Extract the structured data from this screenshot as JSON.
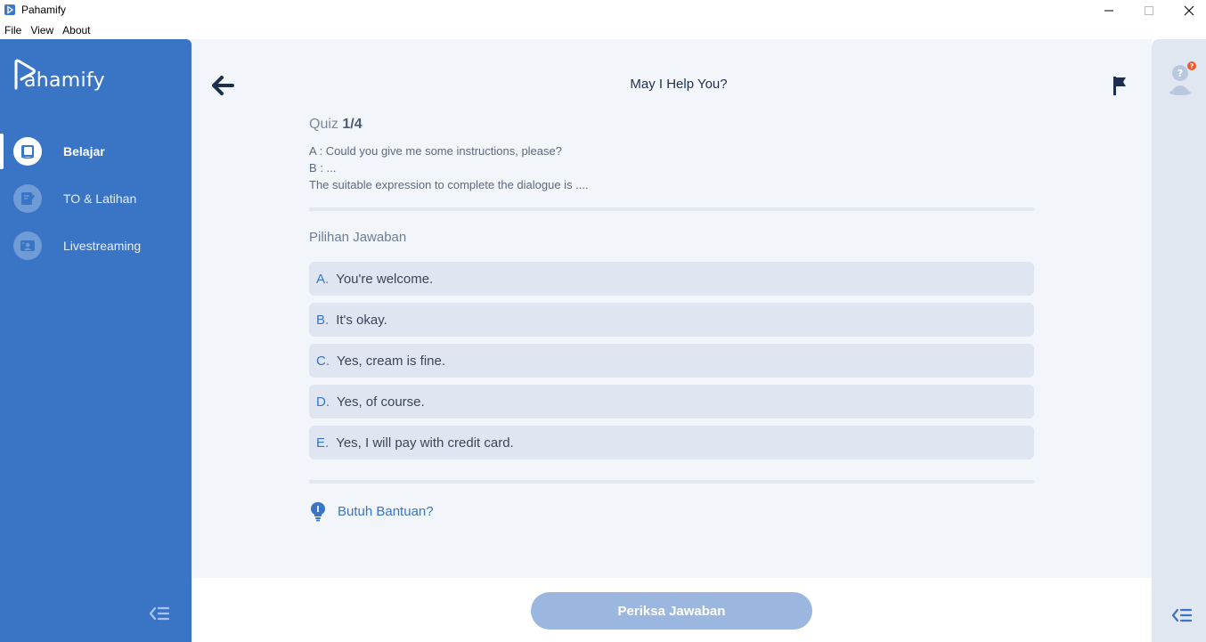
{
  "window": {
    "title": "Pahamify"
  },
  "menu": {
    "items": [
      "File",
      "View",
      "About"
    ]
  },
  "sidebar": {
    "logo_text": "ahamify",
    "items": [
      {
        "label": "Belajar",
        "icon": "book-icon",
        "active": true
      },
      {
        "label": "TO & Latihan",
        "icon": "edit-icon",
        "active": false
      },
      {
        "label": "Livestreaming",
        "icon": "livestream-icon",
        "active": false
      }
    ]
  },
  "header": {
    "title": "May I Help You?"
  },
  "quiz": {
    "label": "Quiz",
    "progress": "1/4",
    "question_lines": [
      "A : Could you give me some instructions, please?",
      "B : ...",
      "The suitable expression to complete the dialogue is ...."
    ],
    "choices_label": "Pilihan Jawaban",
    "choices": [
      {
        "letter": "A.",
        "text": "You're welcome."
      },
      {
        "letter": "B.",
        "text": "It's okay."
      },
      {
        "letter": "C.",
        "text": "Yes, cream is fine."
      },
      {
        "letter": "D.",
        "text": "Yes, of course."
      },
      {
        "letter": "E.",
        "text": "Yes, I will pay with credit card."
      }
    ],
    "help_label": "Butuh Bantuan?"
  },
  "footer": {
    "check_button": "Periksa Jawaban"
  },
  "right_panel": {
    "help_badge": "?"
  },
  "colors": {
    "primary": "#3a75c5",
    "background": "#f2f5f9",
    "button_disabled": "#9cb7df",
    "badge": "#f05a28"
  }
}
